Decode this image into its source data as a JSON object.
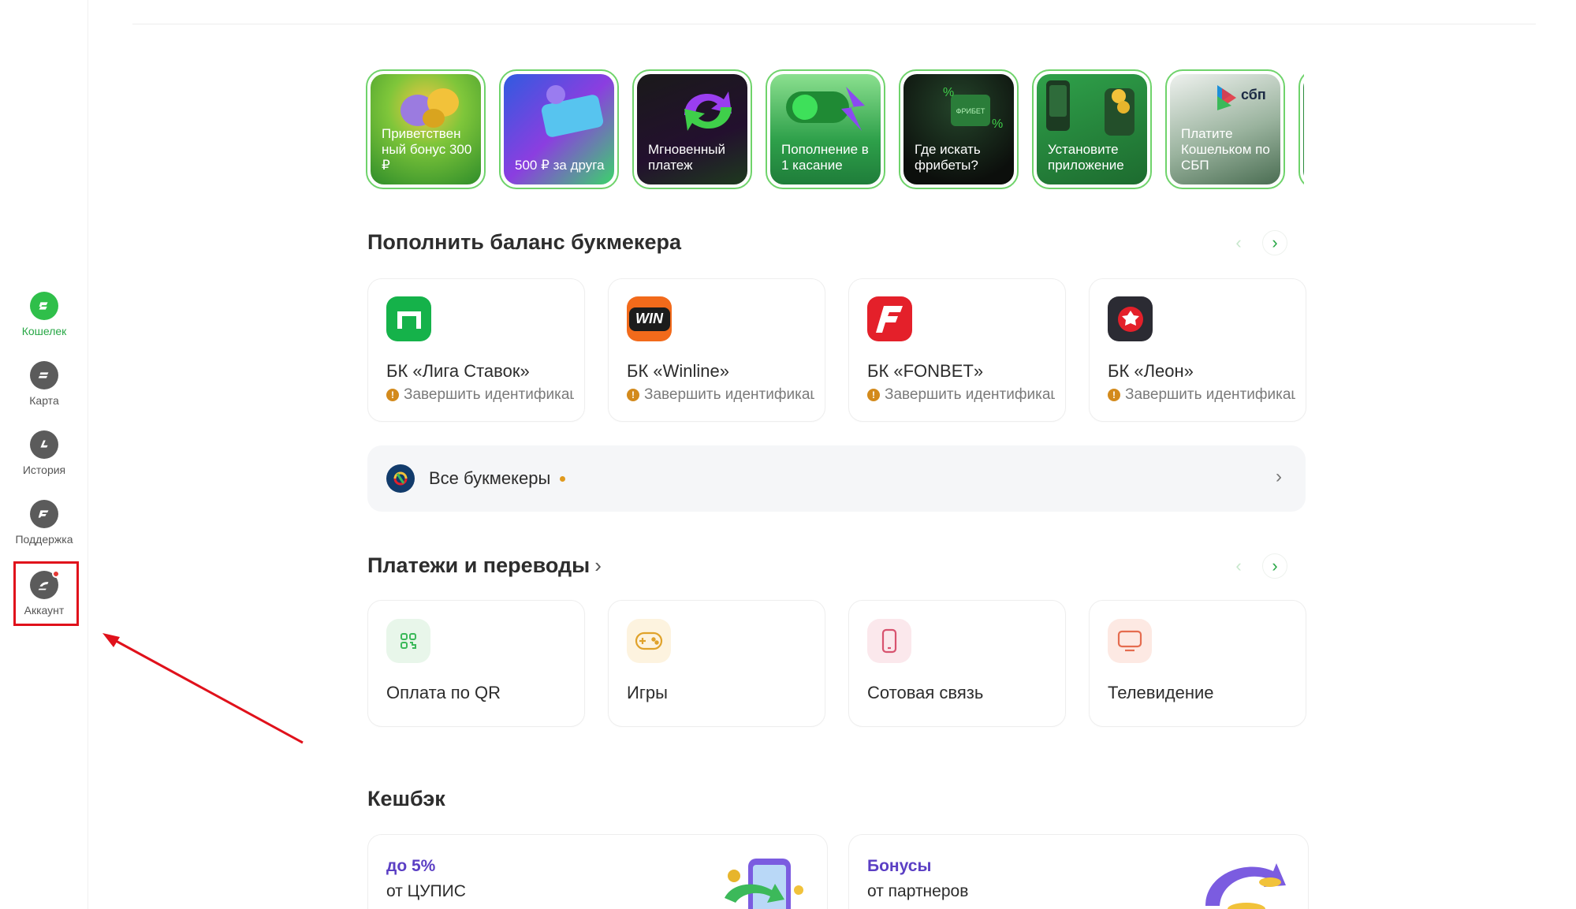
{
  "sidebar": {
    "items": [
      {
        "label": "Кошелек",
        "icon": "wallet-icon",
        "active": true
      },
      {
        "label": "Карта",
        "icon": "card-icon",
        "active": false
      },
      {
        "label": "История",
        "icon": "history-icon",
        "active": false
      },
      {
        "label": "Поддержка",
        "icon": "support-icon",
        "active": false
      },
      {
        "label": "Аккаунт",
        "icon": "account-icon",
        "active": false,
        "notification": true
      }
    ]
  },
  "stories": [
    {
      "text": "Приветствен ный бонус 300 ₽"
    },
    {
      "text": "500 ₽ за друга"
    },
    {
      "text": "Мгновенный платеж"
    },
    {
      "text": "Пополнение в 1 касание"
    },
    {
      "text": "Где искать фрибеты?"
    },
    {
      "text": "Установите приложение"
    },
    {
      "text": "Платите Кошельком по СБП"
    }
  ],
  "story_badges": {
    "sbp": "сбп",
    "freebet": "ФРИБЕТ"
  },
  "bookmakers": {
    "title": "Пополнить баланс букмекера",
    "items": [
      {
        "name": "БК «Лига Ставок»",
        "status": "Завершить идентификацию",
        "color": "#15b24a"
      },
      {
        "name": "БК «Winline»",
        "status": "Завершить идентификацию",
        "color": "#f26a1b",
        "logo_text": "WIN"
      },
      {
        "name": "БК «FONBET»",
        "status": "Завершить идентификацию",
        "color": "#e4202a"
      },
      {
        "name": "БК «Леон»",
        "status": "Завершить идентификацию",
        "color": "#2b2b33"
      }
    ],
    "all_label": "Все букмекеры"
  },
  "payments": {
    "title": "Платежи и переводы",
    "items": [
      {
        "label": "Оплата по QR",
        "icon": "qr-icon",
        "bg": "#e8f6ea",
        "fg": "#3cb95a"
      },
      {
        "label": "Игры",
        "icon": "gamepad-icon",
        "bg": "#fdf3df",
        "fg": "#e0a22a"
      },
      {
        "label": "Сотовая связь",
        "icon": "phone-icon",
        "bg": "#fbe8ec",
        "fg": "#d8536f"
      },
      {
        "label": "Телевидение",
        "icon": "tv-icon",
        "bg": "#fde9e3",
        "fg": "#e56c4f"
      }
    ]
  },
  "cashback": {
    "title": "Кешбэк",
    "items": [
      {
        "title": "до 5%",
        "subtitle": "от ЦУПИС"
      },
      {
        "title": "Бонусы",
        "subtitle": "от партнеров"
      }
    ]
  },
  "colors": {
    "accent": "#27a745",
    "highlight": "#e0111b",
    "cashback_title": "#5b3fc4"
  }
}
